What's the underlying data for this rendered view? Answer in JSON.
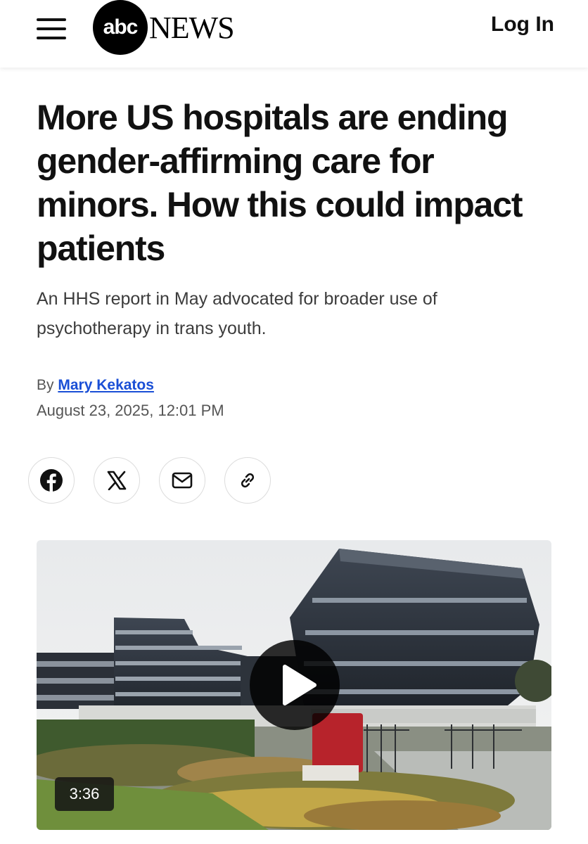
{
  "header": {
    "logo_abc": "abc",
    "logo_news": "NEWS",
    "login_label": "Log In",
    "menu_icon": "hamburger-menu-icon"
  },
  "article": {
    "headline": "More US hospitals are ending gender-affirming care for minors. How this could impact patients",
    "subheadline": "An HHS report in May advocated for broader use of psychotherapy in trans youth.",
    "byline_prefix": "By",
    "author": "Mary Kekatos",
    "date": "August 23, 2025, 12:01 PM"
  },
  "share": [
    {
      "name": "facebook",
      "icon": "facebook-icon"
    },
    {
      "name": "x",
      "icon": "x-icon"
    },
    {
      "name": "email",
      "icon": "mail-icon"
    },
    {
      "name": "copy-link",
      "icon": "link-icon"
    }
  ],
  "video": {
    "duration": "3:36",
    "play_icon": "play-icon"
  },
  "colors": {
    "link": "#1a4fd6",
    "text": "#111111",
    "subtext": "#555555"
  }
}
